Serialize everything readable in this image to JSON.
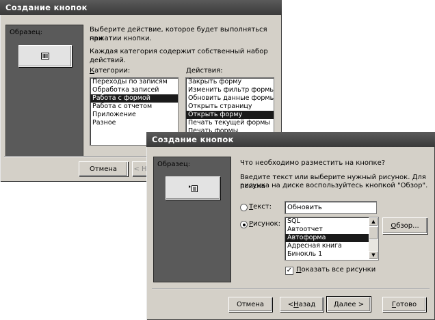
{
  "dialog1": {
    "title": "Создание кнопок",
    "sample_label": "Образец:",
    "intro_line1": "Выберите действие, которое будет выполняться при",
    "intro_line2": "нажатии кнопки.",
    "intro_line3": "Каждая категория содержит собственный набор действий.",
    "categories_label": "Категории:",
    "actions_label": "Действия:",
    "categories": [
      "Переходы по записям",
      "Обработка записей",
      "Работа с формой",
      "Работа с отчетом",
      "Приложение",
      "Разное"
    ],
    "categories_selected": 2,
    "actions": [
      "Закрыть форму",
      "Изменить фильтр формы",
      "Обновить данные формы",
      "Открыть страницу",
      "Открыть форму",
      "Печать текущей формы",
      "Печать формы"
    ],
    "actions_selected": 4,
    "cancel_label": "Отмена",
    "back_label_partial": "< Н"
  },
  "dialog2": {
    "title": "Создание кнопок",
    "sample_label": "Образец:",
    "question": "Что необходимо разместить на кнопке?",
    "hint_line1": "Введите текст или выберите нужный рисунок.  Для поиска",
    "hint_line2": "рисунка на диске воспользуйтесь кнопкой \"Обзор\".",
    "text_option": "Текст:",
    "text_value": "Обновить",
    "picture_option": "Рисунок:",
    "pictures": [
      "SQL",
      "Автоотчет",
      "Автоформа",
      "Адресная книга",
      "Бинокль 1"
    ],
    "pictures_selected": 2,
    "browse_label": "Обзор...",
    "show_all_label": "Показать все рисунки",
    "cancel_label": "Отмена",
    "back_label": "< Назад",
    "next_label": "Далее >",
    "finish_label": "Готово"
  }
}
